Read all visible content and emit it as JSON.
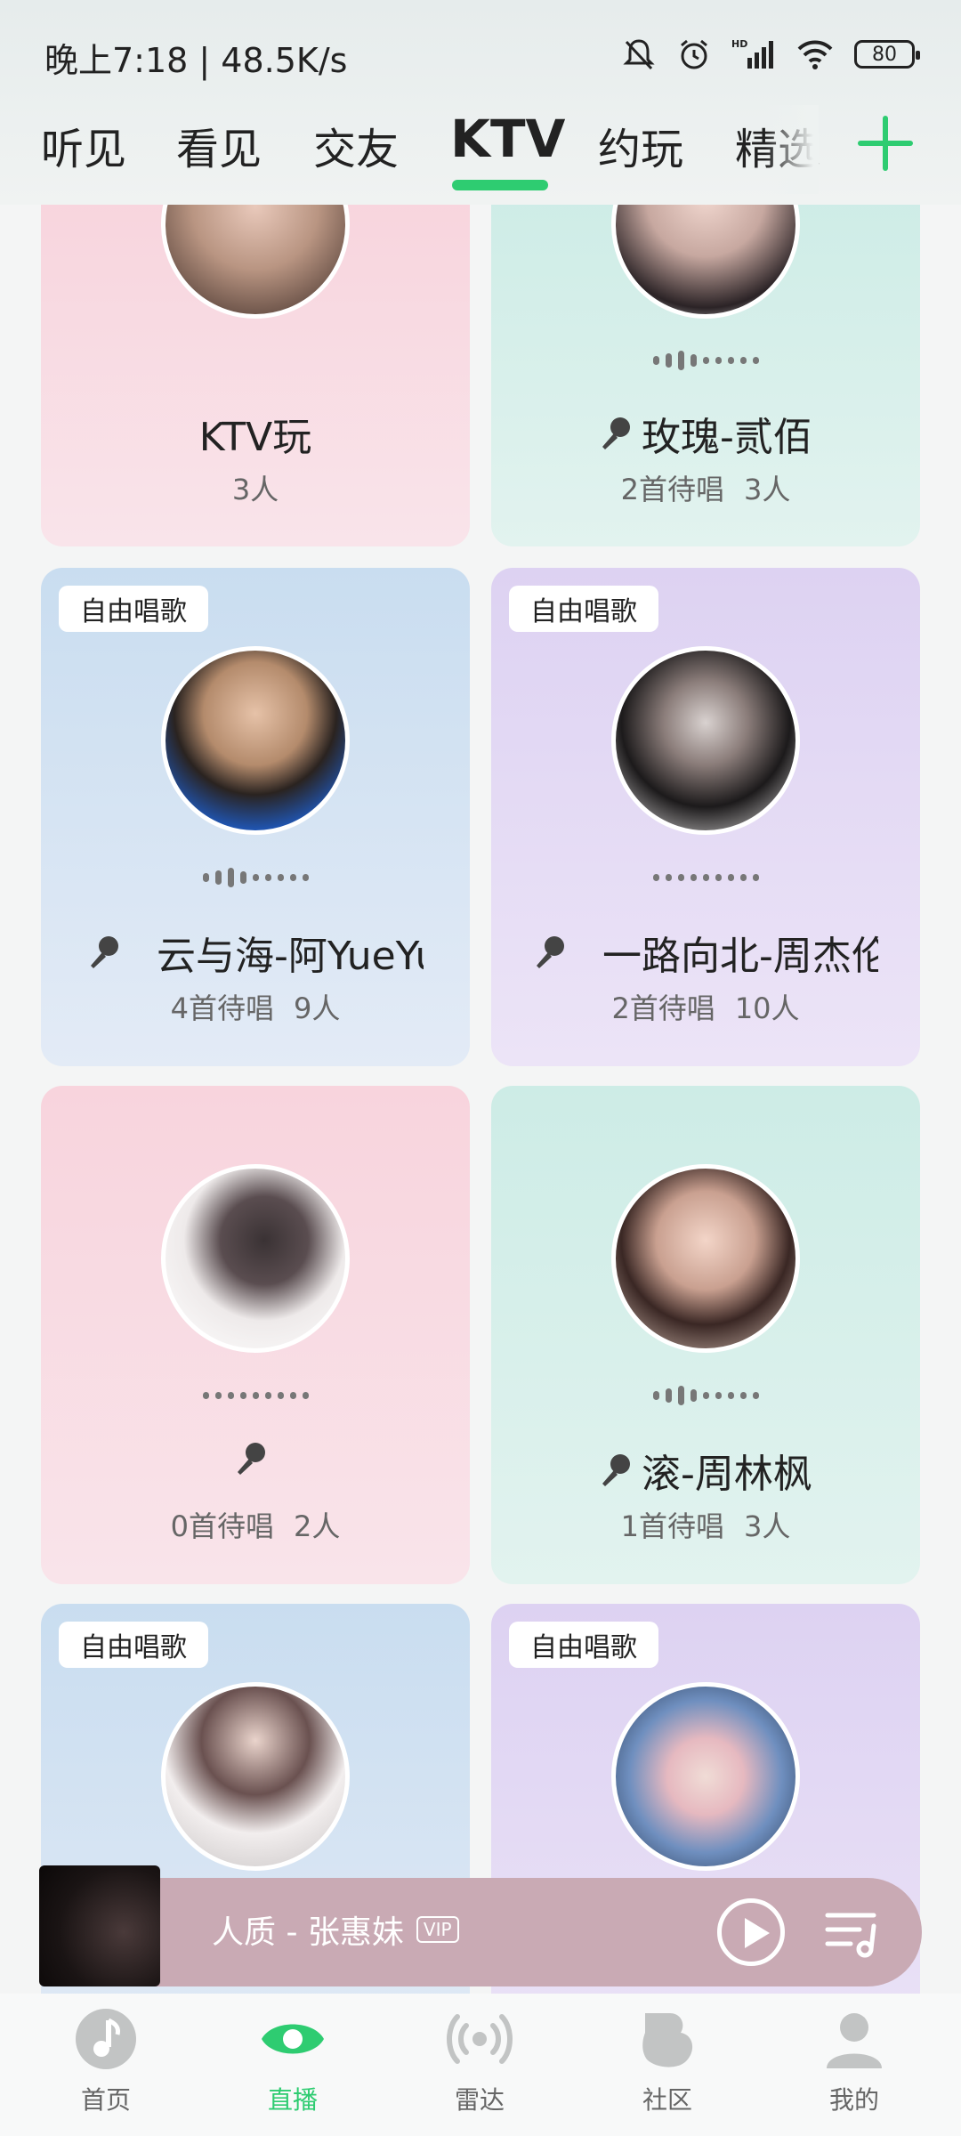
{
  "status_bar": {
    "time": "晚上7:18 | 48.5K/s",
    "battery": "80"
  },
  "tabs": [
    {
      "label": "听见"
    },
    {
      "label": "看见"
    },
    {
      "label": "交友"
    },
    {
      "label": "KTV",
      "active": true
    },
    {
      "label": "约玩"
    },
    {
      "label": "精选"
    }
  ],
  "rooms": [
    {
      "badge": "",
      "song": "KTV玩",
      "pending": "",
      "people": "3人",
      "color": "pink",
      "has_mic": false,
      "has_wave": false
    },
    {
      "badge": "",
      "song": "玫瑰-贰佰",
      "pending": "2首待唱",
      "people": "3人",
      "color": "mint",
      "has_mic": true,
      "has_wave": true
    },
    {
      "badge": "自由唱歌",
      "song": "云与海-阿YueYue",
      "pending": "4首待唱",
      "people": "9人",
      "color": "blue",
      "has_mic": true,
      "has_wave": true
    },
    {
      "badge": "自由唱歌",
      "song": "一路向北-周杰伦",
      "pending": "2首待唱",
      "people": "10人",
      "color": "purple",
      "has_mic": true,
      "has_wave": true
    },
    {
      "badge": "",
      "song": "",
      "pending": "0首待唱",
      "people": "2人",
      "color": "pink",
      "has_mic": true,
      "has_wave": true
    },
    {
      "badge": "",
      "song": "滚-周林枫",
      "pending": "1首待唱",
      "people": "3人",
      "color": "mint",
      "has_mic": true,
      "has_wave": true
    },
    {
      "badge": "自由唱歌",
      "song": "",
      "pending": "",
      "people": "",
      "color": "blue",
      "has_mic": false,
      "has_wave": false
    },
    {
      "badge": "自由唱歌",
      "song": "",
      "pending": "",
      "people": "",
      "color": "purple",
      "has_mic": false,
      "has_wave": false
    }
  ],
  "player": {
    "title": "人质 - 张惠妹",
    "vip": "VIP"
  },
  "bottom_nav": [
    {
      "label": "首页",
      "icon": "music-note-icon"
    },
    {
      "label": "直播",
      "icon": "eye-icon",
      "active": true
    },
    {
      "label": "雷达",
      "icon": "radar-icon"
    },
    {
      "label": "社区",
      "icon": "community-icon"
    },
    {
      "label": "我的",
      "icon": "profile-icon"
    }
  ],
  "colors": {
    "accent": "#2ecc71"
  }
}
